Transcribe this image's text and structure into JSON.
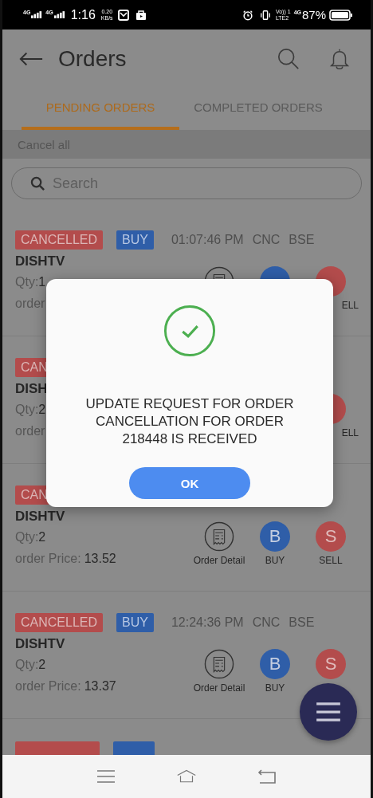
{
  "status_bar": {
    "net_1": "4G",
    "net_2": "4G",
    "time": "1:16",
    "speed": "0.20",
    "speed_unit": "KB/s",
    "volte": "Vo)) 1",
    "lte": "LTE2",
    "net_3": "4G",
    "battery": "87%"
  },
  "header": {
    "title": "Orders"
  },
  "tabs": [
    {
      "label": "PENDING ORDERS",
      "selected": true
    },
    {
      "label": "COMPLETED ORDERS",
      "selected": false
    }
  ],
  "cancel_all": "Cancel all",
  "search": {
    "placeholder": "Search"
  },
  "orders": [
    {
      "covered": true,
      "status": "CANCELLED",
      "side": "BUY",
      "time": "01:07:46 PM",
      "product": "CNC",
      "exchange": "BSE",
      "symbol": "DISHTV",
      "qty_label": "Qty:",
      "qty": "1",
      "price_label": "order",
      "actions": [
        {
          "kind": "detail"
        },
        {
          "kind": "buy"
        },
        {
          "kind": "sell",
          "label": "ELL"
        }
      ]
    },
    {
      "covered": true,
      "status": "CAN",
      "symbol": "DISH",
      "qty_label": "Qty:",
      "qty": "2",
      "price_label": "order",
      "actions": [
        {
          "kind": "sell",
          "label": "ELL"
        }
      ]
    },
    {
      "covered": false,
      "status": "CAN",
      "symbol": "DISHTV",
      "qty_label": "Qty:",
      "qty": "2",
      "price_label": "order Price:",
      "price": "13.52",
      "actions": [
        {
          "kind": "detail",
          "label": "Order Detail"
        },
        {
          "kind": "buy",
          "letter": "B",
          "label": "BUY"
        },
        {
          "kind": "sell",
          "letter": "S",
          "label": "SELL"
        }
      ]
    },
    {
      "covered": false,
      "status": "CANCELLED",
      "side": "BUY",
      "time": "12:24:36 PM",
      "product": "CNC",
      "exchange": "BSE",
      "symbol": "DISHTV",
      "qty_label": "Qty:",
      "qty": "2",
      "price_label": "order Price:",
      "price": "13.37",
      "actions": [
        {
          "kind": "detail",
          "label": "Order Detail"
        },
        {
          "kind": "buy",
          "letter": "B",
          "label": "BUY"
        },
        {
          "kind": "sell",
          "letter": "S"
        }
      ]
    }
  ],
  "dialog": {
    "message": "UPDATE REQUEST FOR ORDER CANCELLATION FOR ORDER 218448 IS RECEIVED",
    "button": "OK"
  }
}
